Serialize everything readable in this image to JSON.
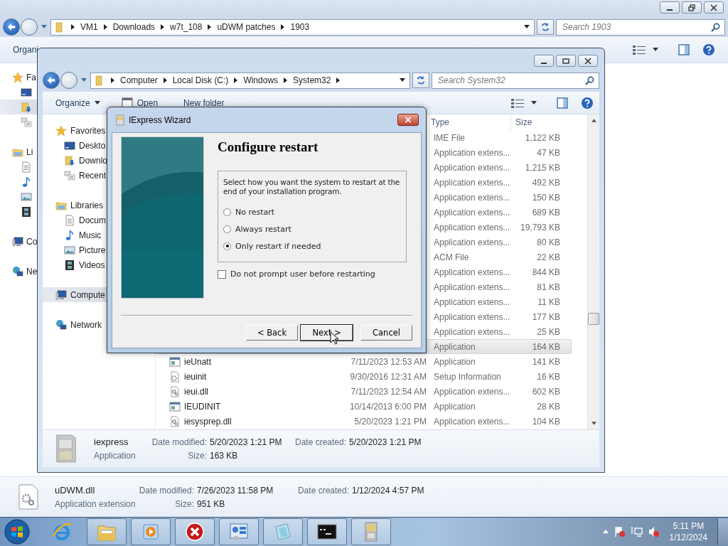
{
  "back_window": {
    "address": [
      "VM1",
      "Downloads",
      "w7t_108",
      "uDWM patches",
      "1903"
    ],
    "search": {
      "placeholder": "Search 1903"
    },
    "toolbar": {
      "organize": "Organi"
    },
    "nav": [
      {
        "label": "Fa",
        "kind": "favorites",
        "selected": false,
        "children": [
          {
            "kind": "desktop",
            "selected": false
          },
          {
            "kind": "downloads",
            "selected": true
          },
          {
            "kind": "recent",
            "selected": false
          }
        ]
      },
      {
        "label": "Li",
        "kind": "libraries",
        "selected": false,
        "children": [
          {
            "kind": "documents",
            "selected": false
          },
          {
            "kind": "music",
            "selected": false
          },
          {
            "kind": "pictures",
            "selected": false
          },
          {
            "kind": "videos",
            "selected": false
          }
        ]
      },
      {
        "label": "Co",
        "kind": "computer",
        "selected": false
      },
      {
        "label": "Ne",
        "kind": "network",
        "selected": false
      }
    ],
    "details": {
      "name": "uDWM.dll",
      "type": "Application extension",
      "modified_label": "Date modified:",
      "modified": "7/26/2023 11:58 PM",
      "size_label": "Size:",
      "size": "951 KB",
      "created_label": "Date created:",
      "created": "1/12/2024 4:57 PM"
    }
  },
  "front_window": {
    "address": [
      "Computer",
      "Local Disk (C:)",
      "Windows",
      "System32"
    ],
    "search": {
      "placeholder": "Search System32"
    },
    "toolbar": {
      "organize": "Organize",
      "open": "Open",
      "new_folder": "New folder"
    },
    "nav": [
      {
        "label": "Favorites",
        "kind": "favorites",
        "selected": false,
        "children": [
          {
            "label": "Deskto",
            "kind": "desktop",
            "selected": false
          },
          {
            "label": "Downlo",
            "kind": "downloads",
            "selected": false
          },
          {
            "label": "Recent",
            "kind": "recent",
            "selected": false
          }
        ]
      },
      {
        "label": "Libraries",
        "kind": "libraries",
        "selected": false,
        "children": [
          {
            "label": "Docum",
            "kind": "documents",
            "selected": false
          },
          {
            "label": "Music",
            "kind": "music",
            "selected": false
          },
          {
            "label": "Picture",
            "kind": "pictures",
            "selected": false
          },
          {
            "label": "Videos",
            "kind": "videos",
            "selected": false
          }
        ]
      },
      {
        "label": "Compute",
        "kind": "computer",
        "selected": true
      },
      {
        "label": "Network",
        "kind": "network",
        "selected": false
      }
    ],
    "columns": [
      "Type",
      "Size"
    ],
    "rows": [
      {
        "type": "IME File",
        "size": "1,122 KB",
        "selected": false
      },
      {
        "type": "Application extens...",
        "size": "47 KB",
        "selected": false
      },
      {
        "type": "Application extens...",
        "size": "1,215 KB",
        "selected": false
      },
      {
        "type": "Application extens...",
        "size": "492 KB",
        "selected": false
      },
      {
        "type": "Application extens...",
        "size": "150 KB",
        "selected": false
      },
      {
        "type": "Application extens...",
        "size": "689 KB",
        "selected": false
      },
      {
        "type": "Application extens...",
        "size": "19,793 KB",
        "selected": false
      },
      {
        "type": "Application extens...",
        "size": "80 KB",
        "selected": false
      },
      {
        "type": "ACM File",
        "size": "22 KB",
        "selected": false
      },
      {
        "type": "Application extens...",
        "size": "844 KB",
        "selected": false
      },
      {
        "type": "Application extens...",
        "size": "81 KB",
        "selected": false
      },
      {
        "type": "Application extens...",
        "size": "11 KB",
        "selected": false
      },
      {
        "type": "Application extens...",
        "size": "177 KB",
        "selected": false
      },
      {
        "type": "Application extens...",
        "size": "25 KB",
        "selected": false
      },
      {
        "type": "Application",
        "size": "164 KB",
        "selected": true
      },
      {
        "kind": "app",
        "name": "ieUnatt",
        "date": "7/11/2023 12:53 AM",
        "type": "Application",
        "size": "141 KB",
        "selected": false
      },
      {
        "kind": "setup",
        "name": "ieuinit",
        "date": "9/30/2016 12:31 AM",
        "type": "Setup Information",
        "size": "16 KB",
        "selected": false
      },
      {
        "kind": "dll",
        "name": "ieui.dll",
        "date": "7/11/2023 12:54 AM",
        "type": "Application extens...",
        "size": "602 KB",
        "selected": false
      },
      {
        "kind": "app",
        "name": "IEUDINIT",
        "date": "10/14/2013 6:00 PM",
        "type": "Application",
        "size": "28 KB",
        "selected": false
      },
      {
        "kind": "dll",
        "name": "iesysprep.dll",
        "date": "5/20/2023 1:21 PM",
        "type": "Application extens...",
        "size": "104 KB",
        "selected": false
      }
    ],
    "details": {
      "name": "iexpress",
      "type": "Application",
      "modified_label": "Date modified:",
      "modified": "5/20/2023 1:21 PM",
      "size_label": "Size:",
      "size": "163 KB",
      "created_label": "Date created:",
      "created": "5/20/2023 1:21 PM"
    }
  },
  "dialog": {
    "title": "IExpress Wizard",
    "heading": "Configure restart",
    "prompt": "Select how you want the system to restart at the end of your installation program.",
    "options": [
      {
        "label": "No restart",
        "selected": false
      },
      {
        "label": "Always restart",
        "selected": false
      },
      {
        "label": "Only restart if needed",
        "selected": true
      }
    ],
    "checkbox": {
      "label": "Do not prompt user before restarting",
      "checked": false
    },
    "buttons": [
      {
        "label": "< Back",
        "default": false
      },
      {
        "label": "Next >",
        "default": true
      },
      {
        "label": "Cancel",
        "default": false
      }
    ]
  },
  "taskbar": {
    "apps": [
      {
        "kind": "ie",
        "open": false
      },
      {
        "kind": "explorer",
        "open": true
      },
      {
        "kind": "media",
        "open": true
      },
      {
        "kind": "error",
        "open": true
      },
      {
        "kind": "control",
        "open": true
      },
      {
        "kind": "notepad",
        "open": true
      },
      {
        "kind": "cmd",
        "open": true
      },
      {
        "kind": "cabinet",
        "open": true
      }
    ],
    "time": "5:11 PM",
    "date": "1/12/2024"
  }
}
